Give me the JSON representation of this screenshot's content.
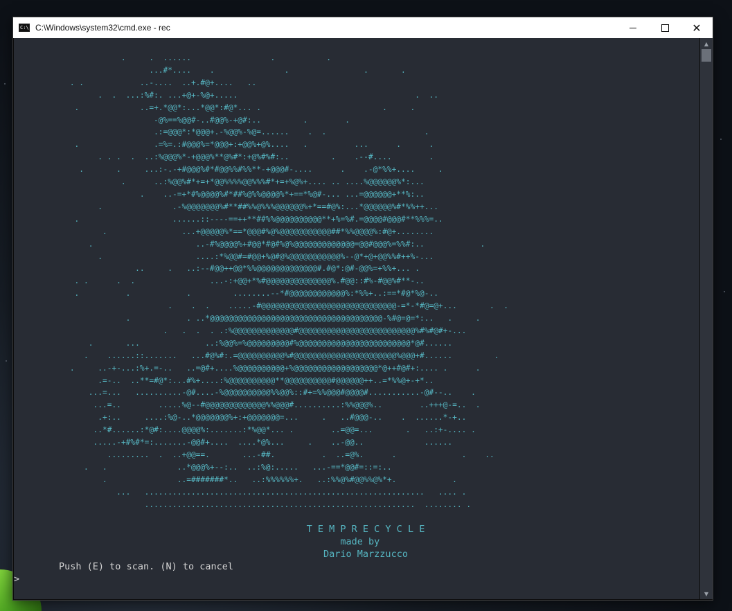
{
  "window": {
    "title": "C:\\Windows\\system32\\cmd.exe - rec",
    "icon": "cmd-icon",
    "controls": {
      "minimize": "minimize-icon",
      "maximize": "maximize-icon",
      "close": "close-icon"
    }
  },
  "console": {
    "art": "                       .     .  ......                 .           .\n                             ...#*....    .               .                .       .\n            . .            ..-....  ..+.#@+....   ..\n                  .  .  ...:%#:. ...+@+-%@+.....                                      .  ..\n             .             ..=+.*@@*:...*@@*:#@*... .                          .     .\n                              -@%==%@@#-..#@@%-+@#:..         .        .\n                              .:=@@@*:*@@@+.-%@@%-%@=......    .  .                     .\n             .                .=%=.:#@@@%=*@@@+:+@@%+@%....   .          ...      .      .\n                  . . .  .  ..:%@@@%*-+@@@%**@%#*:+@%#%#:..         .    .--#....        .\n              .       .     ...:-.-+#@@@%#*#@@%%#%%**-+@@@#-....      .    .-@*%%+....     .\n                       .      ..:%@@%#*+=+*@@%%%%@@%%%#*+=+%@%+.... .. ....%@@@@@@%*:...\n                           .    ..-=+*#%@@@@%#*##%@%%@@@@%*+==*%@#-... ...=@@@@@@+**%:..\n                  .               .-%@@@@@@@%#**##%%@%%%@@@@@@%+*==#@%:...*@@@@@@%#*%%++...\n             .                    ......::----==++**##%%@@@@@@@@@@**+%=%#.=@@@@#@@@#**%%%=..\n                   .                ...+@@@@@%*==*@@@#%@%@@@@@@@@@@@##*%%@@@@%:#@+........\n                .                      ..-#%@@@@%+#@@*#@#%@%@@@@@@@@@@@@@=@@#@@@%=%%#:..            .\n                  .                    ....:*%@@#=#@@+%@#@%@@@@@@@@@@@%--@*+@+@@%%#++%-...\n                          ..     .   ..:--#@@++@@*%%@@@@@@@@@@@@@#.#@*:@#-@@%=+%%+... .\n             . .      .  .                ...-:+@@+*%#@@@@@@@@@@@@@@%.#@@::#%-#@@%#**-..\n             .          .            .         ........--*#@@@@@@@@@@@@%:*%%+..:==*#@*%@-..\n                                 .    .  .    .....-#@@@@@@@@@@@@@@@@@@@@@@@@@@@@@-=*-*#@=@+...       .  .\n                        .            . ..*@@@@@@@@@@@@@@@@@@@@@@@@@@@@@@@@@@@@@-%#@=@=*:..   .     .\n                                .   .  .  . .:%@@@@@@@@@@@@@#@@@@@@@@@@@@@@@@@@@@@@@@@%#%#@#+-...\n                .       ...              ..:%@@%=%@@@@@@@@@#%@@@@@@@@@@@@@@@@@@@@@@@@*@#......\n               .    ......::.......   ...#@%#:.=@@@@@@@@@@%#@@@@@@@@@@@@@@@@@@@@@@%@@@+#......         .\n            .     ..-+-...:%+.=-..   ..=@#+....%@@@@@@@@@@+%@@@@@@@@@@@@@@@@@@*@++#@#+:.... .      .\n                  .=-..  ..**=#@*:...#%+....:%@@@@@@@@@@**@@@@@@@@@@#@@@@@@++..=*%%@+-+*..\n                ...=...   ..........-@#....-%@@@@@@@@@@%%@@%::#+=%%@@@#@@@@#...........-@#--..    .\n                 ...=..        .....%@--#@@@@@@@@@@@@@%%@@@#..........:%%@@@%..        ..+++@-=..  .\n                  .+:..     ....:%@-..*@@@@@@@%+:+@@@@@@@=...     .   ..#@@@-..    .  ......*-+..\n                 ..*#......:*@#:....@@@@%:.......:*%@@*... .        ..=@@=...       .   ..:+-.... .\n                 .....-+#%#*=:.......-@@#+....  ....*@%...     .    ..-@@..             ......\n                    .........  .  ..+@@==.       ...-##.          .  ..=@%.      .              .    ..\n               .   .               ..*@@@%+--:..  ..:%@:.....   ...-==*@@#=::=:..\n                   .               ..=#######*..   ..:%%%%%%+.   ..:%%@%#@@%%@%*+.            .\n                      ...   ............................................................   .... .\n                            ..........................................................  ........ ."
  },
  "credits": {
    "title": "T E M P R E C Y C L E",
    "made_by": "made by",
    "author": "Dario Marzzucco"
  },
  "prompt": {
    "message": "Push (E) to scan. (N) to cancel",
    "cursor": ">"
  }
}
